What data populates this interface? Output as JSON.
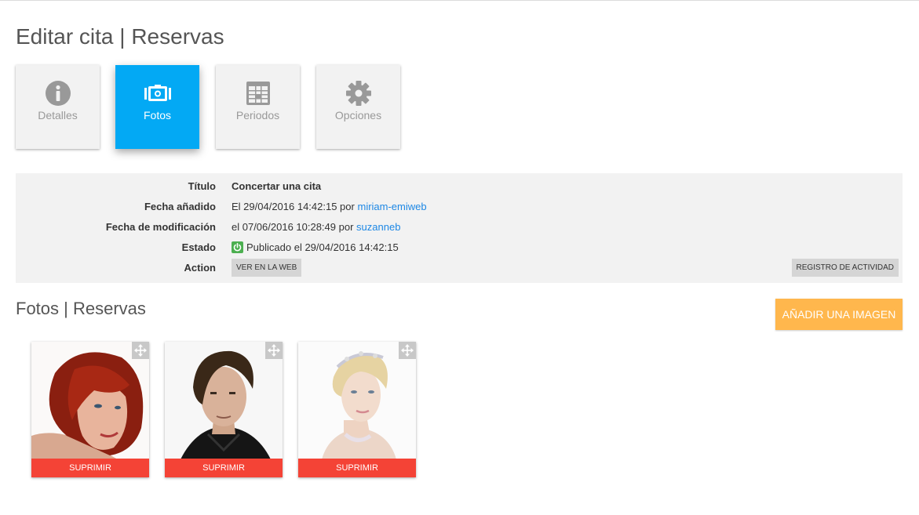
{
  "page": {
    "title": "Editar cita | Reservas"
  },
  "tabs": [
    {
      "label": "Detalles",
      "icon": "info-icon",
      "active": false
    },
    {
      "label": "Fotos",
      "icon": "photos-icon",
      "active": true
    },
    {
      "label": "Periodos",
      "icon": "calendar-icon",
      "active": false
    },
    {
      "label": "Opciones",
      "icon": "gear-icon",
      "active": false
    }
  ],
  "info": {
    "titulo_label": "Título",
    "titulo_value": "Concertar una cita",
    "added_label": "Fecha añadido",
    "added_prefix": "El 29/04/2016 14:42:15 por",
    "added_user": "miriam-emiweb",
    "modified_label": "Fecha de modificación",
    "modified_prefix": "el 07/06/2016 10:28:49 por",
    "modified_user": "suzanneb",
    "estado_label": "Estado",
    "estado_value": "Publicado el 29/04/2016 14:42:15",
    "action_label": "Action",
    "view_web_label": "VER EN LA WEB",
    "activity_label": "REGISTRO DE ACTIVIDAD"
  },
  "photos_section": {
    "title": "Fotos | Reservas",
    "add_label": "AÑADIR UNA IMAGEN",
    "photos": [
      {
        "delete_label": "SUPRIMIR"
      },
      {
        "delete_label": "SUPRIMIR"
      },
      {
        "delete_label": "SUPRIMIR"
      }
    ]
  },
  "colors": {
    "active_tab": "#03a9f4",
    "add_button": "#ffb74d",
    "delete_button": "#f44336",
    "status_green": "#4caf50",
    "link": "#1e88e5"
  }
}
